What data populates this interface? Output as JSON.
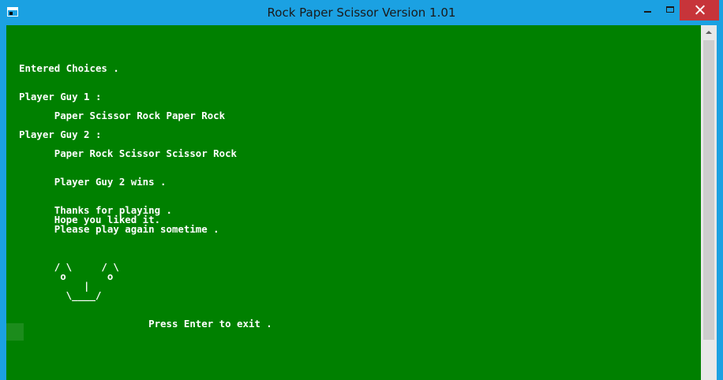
{
  "window": {
    "title": "Rock Paper Scissor Version 1.01",
    "icon": "console-app-icon",
    "controls": {
      "minimize_icon": "minimize-icon",
      "maximize_icon": "maximize-icon",
      "close_icon": "close-icon"
    },
    "colors": {
      "frame": "#1ba1e2",
      "console_background": "#008000",
      "console_text": "#ffffff",
      "close_button": "#c7343a"
    }
  },
  "console": {
    "lines": [
      "",
      "Entered Choices .",
      "",
      "",
      "Player Guy 1 :",
      "",
      "      Paper Scissor Rock Paper Rock",
      "",
      "Player Guy 2 :",
      "",
      "      Paper Rock Scissor Scissor Rock",
      "",
      "",
      "      Player Guy 2 wins .",
      "",
      "",
      "      Thanks for playing .",
      "      Hope you liked it.",
      "      Please play again sometime .",
      "",
      "",
      "",
      "      / \\     / \\",
      "       o       o",
      "           |",
      "        \\____/",
      "",
      "",
      "                      Press Enter to exit ."
    ]
  }
}
